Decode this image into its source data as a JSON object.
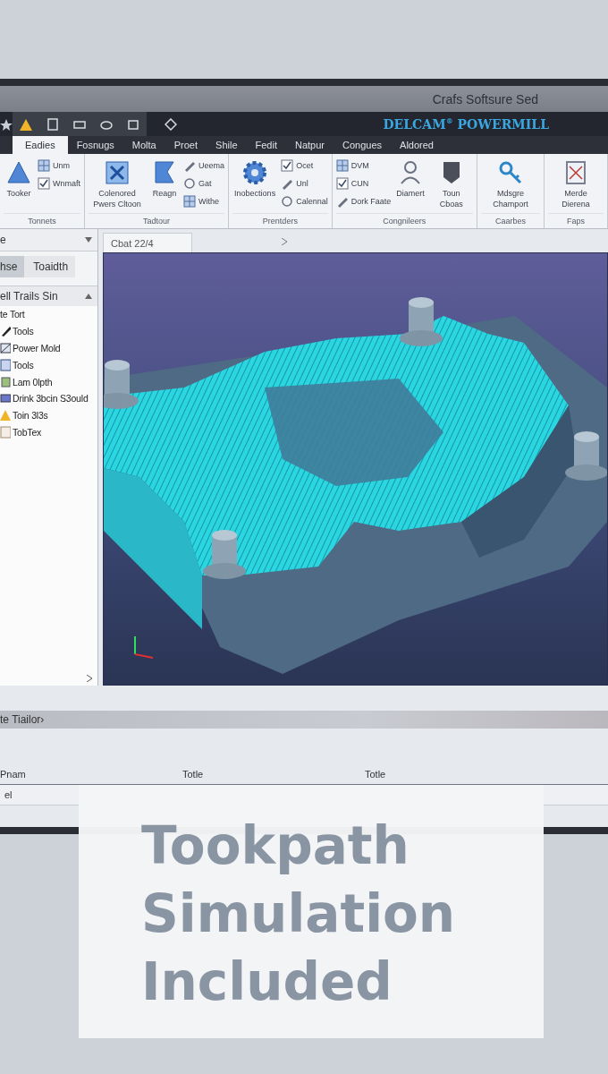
{
  "window": {
    "title": "Crafs Softsure Sed",
    "brand": "DELCAM$^{®}$ POWERMILL"
  },
  "ribbon_tabs": [
    {
      "label": "Eadies",
      "selected": true
    },
    {
      "label": "Fosnugs",
      "selected": false
    },
    {
      "label": "Molta",
      "selected": false
    },
    {
      "label": "Proet",
      "selected": false
    },
    {
      "label": "Shile",
      "selected": false
    },
    {
      "label": "Fedit",
      "selected": false
    },
    {
      "label": "Natpur",
      "selected": false
    },
    {
      "label": "Congues",
      "selected": false
    },
    {
      "label": "Aldored",
      "selected": false
    }
  ],
  "ribbon_groups": [
    {
      "label": "Tonnets",
      "items": [
        {
          "kind": "large",
          "label": "Tooker"
        },
        {
          "kind": "small",
          "label": "Unm"
        },
        {
          "kind": "small",
          "label": "Wnmaft"
        }
      ]
    },
    {
      "label": "Tadtour",
      "items": [
        {
          "kind": "large",
          "label": "Colenored Pwers Cltoon"
        },
        {
          "kind": "large",
          "label": "Reagn"
        },
        {
          "kind": "small",
          "label": "Ueema"
        },
        {
          "kind": "small",
          "label": "Gat"
        },
        {
          "kind": "small",
          "label": "Withe"
        }
      ]
    },
    {
      "label": "Prentders",
      "items": [
        {
          "kind": "large",
          "label": "Inobections"
        },
        {
          "kind": "small",
          "label": "Ocet"
        },
        {
          "kind": "small",
          "label": "Unl"
        },
        {
          "kind": "small",
          "label": "Calennal"
        }
      ]
    },
    {
      "label": "Congnileers",
      "items": [
        {
          "kind": "small",
          "label": "DVM"
        },
        {
          "kind": "small",
          "label": "CUN"
        },
        {
          "kind": "small",
          "label": "Dork Faate"
        },
        {
          "kind": "large",
          "label": "Diamert"
        },
        {
          "kind": "large",
          "label": "Toun Cboas"
        }
      ]
    },
    {
      "label": "Caarbes",
      "items": [
        {
          "kind": "large",
          "label": "Mdsgre Champort"
        }
      ]
    },
    {
      "label": "Faps",
      "items": [
        {
          "kind": "large",
          "label": "Merde Dierena"
        }
      ]
    }
  ],
  "side_panel": {
    "dropdown": "e",
    "tabs": [
      {
        "label": "hse",
        "selected": true
      },
      {
        "label": "Toaidth",
        "selected": false
      }
    ],
    "tree_header": "ell Trails Sin",
    "items": [
      "te Tort",
      "Tools",
      "Power Mold",
      "Tools",
      "Lam 0lpth",
      "Drink 3bcin S3ould",
      "Toin 3l3s",
      "TobTex"
    ]
  },
  "viewport": {
    "tab": "Cbat 22/4"
  },
  "bottom_panel": {
    "title": "te Tiailor›",
    "columns": [
      "Pnam",
      "Totle",
      "Totle"
    ],
    "rows": [
      [
        "el"
      ]
    ]
  },
  "promo": {
    "lines": [
      "Tookpath",
      "Simulation",
      "Included"
    ]
  }
}
